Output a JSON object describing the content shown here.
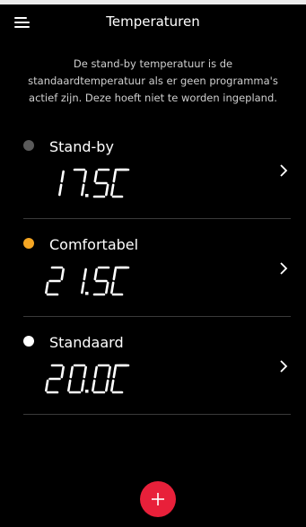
{
  "header": {
    "title": "Temperaturen"
  },
  "description": "De stand-by temperatuur is de standaardtemperatuur als er geen programma's actief zijn. Deze hoeft niet te worden ingepland.",
  "temperatures": [
    {
      "label": "Stand-by",
      "value": "17.5",
      "display": "17.5°C",
      "dot_color": "#5a5a5a"
    },
    {
      "label": "Comfortabel",
      "value": "21.5",
      "display": "21.5°C",
      "dot_color": "#f5a623"
    },
    {
      "label": "Standaard",
      "value": "20.0",
      "display": "20.0°C",
      "dot_color": "#ffffff"
    }
  ],
  "colors": {
    "background": "#000000",
    "add_button": "#e8203a",
    "divider": "#3a3a3a"
  },
  "icons": {
    "menu": "hamburger-icon",
    "chevron": "chevron-right-icon",
    "add": "plus-icon"
  }
}
